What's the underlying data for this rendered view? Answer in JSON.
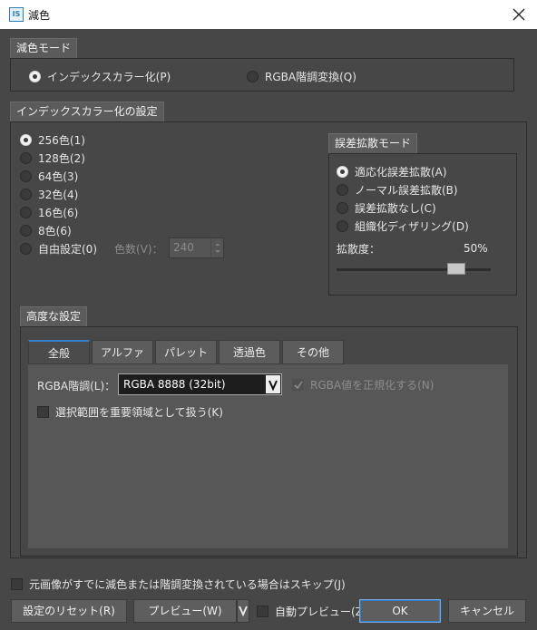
{
  "window": {
    "title": "減色",
    "app_icon_text": "IS"
  },
  "mode_group": {
    "title": "減色モード",
    "options": [
      "インデックスカラー化(P)",
      "RGBA階調変換(Q)"
    ]
  },
  "index_group": {
    "title": "インデックスカラー化の設定",
    "color_options": [
      "256色(1)",
      "128色(2)",
      "64色(3)",
      "32色(4)",
      "16色(6)",
      "8色(6)",
      "自由設定(0)"
    ],
    "color_count_label": "色数(V)：",
    "color_count_value": "240"
  },
  "diffusion_group": {
    "title": "誤差拡散モード",
    "options": [
      "適応化誤差拡散(A)",
      "ノーマル誤差拡散(B)",
      "誤差拡散なし(C)",
      "組織化ディザリング(D)"
    ],
    "strength_label": "拡散度：",
    "strength_value": "50%",
    "strength_fraction": 0.5
  },
  "advanced_group": {
    "title": "高度な設定",
    "tabs": [
      "全般",
      "アルファ",
      "パレット",
      "透過色",
      "その他"
    ],
    "rgba_label": "RGBA階調(L)：",
    "rgba_value": "RGBA 8888 (32bit)",
    "normalize_label": "RGBA値を正規化する(N)",
    "selection_label": "選択範囲を重要領域として扱う(K)"
  },
  "footer": {
    "skip_label": "元画像がすでに減色または階調変換されている場合はスキップ(J)",
    "reset_button": "設定のリセット(R)",
    "preview_button": "プレビュー(W)",
    "auto_preview_label": "自動プレビュー(Z)",
    "ok_button": "OK",
    "cancel_button": "キャンセル"
  }
}
